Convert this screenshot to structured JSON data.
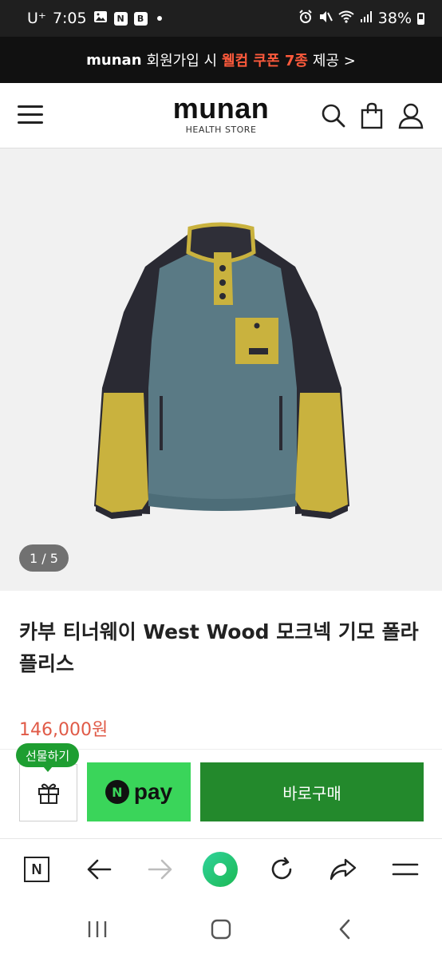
{
  "status_bar": {
    "carrier": "U⁺",
    "time": "7:05",
    "app_badges": [
      "N",
      "B"
    ],
    "battery": "38%"
  },
  "promo": {
    "brand": "munan",
    "prefix": "회원가입 시",
    "highlight": "웰컴 쿠폰 7종",
    "suffix": "제공 >"
  },
  "header": {
    "logo": "munan",
    "logo_sub": "HEALTH STORE"
  },
  "gallery": {
    "counter": "1 / 5"
  },
  "product": {
    "title": "카부 티너웨이 West Wood 모크넥 기모 폴라플리스",
    "price": "146,000원"
  },
  "buybar": {
    "gift_badge": "선물하기",
    "npay_n": "N",
    "npay_label": "pay",
    "buy_label": "바로구매"
  },
  "browser_bar": {
    "naver_label": "N"
  },
  "colors": {
    "promo_highlight": "#ff5a3c",
    "price": "#e05a47",
    "npay_green": "#3ad55a",
    "buy_green": "#23892c",
    "gift_badge": "#1e9e31"
  }
}
